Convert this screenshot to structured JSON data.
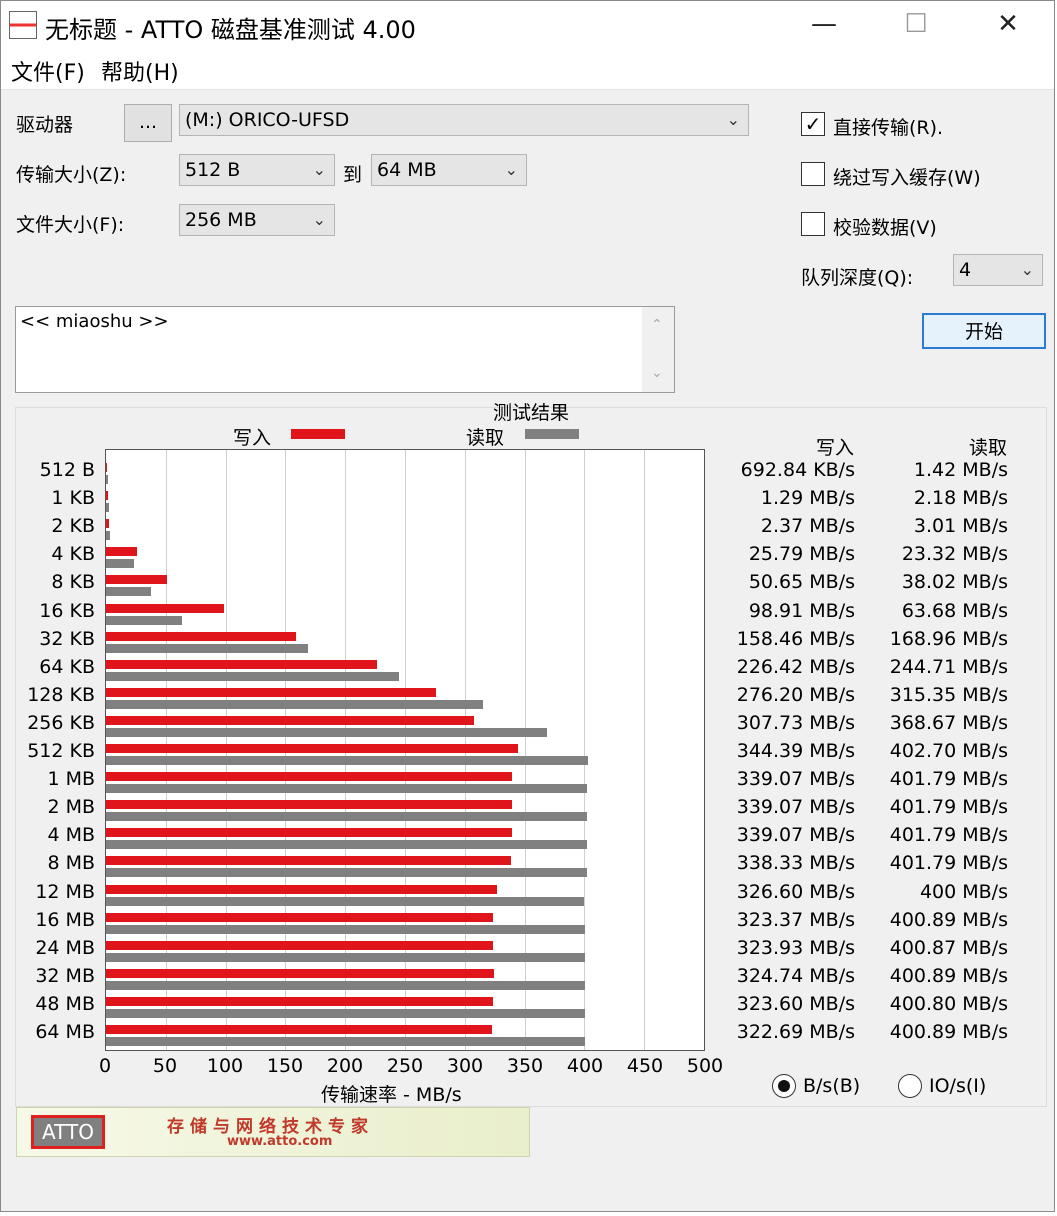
{
  "window": {
    "title": "无标题 - ATTO 磁盘基准测试 4.00",
    "minimize": "—",
    "maximize": "☐",
    "close": "✕"
  },
  "menu": [
    "文件(F)",
    "帮助(H)"
  ],
  "settings": {
    "drive_label": "驱动器",
    "browse_button": "...",
    "drive_value": "(M:) ORICO-UFSD",
    "transfer_label": "传输大小(Z):",
    "transfer_from": "512 B",
    "to_label": "到",
    "transfer_to": "64 MB",
    "file_size_label": "文件大小(F):",
    "file_size": "256 MB",
    "direct_io": {
      "label": "直接传输(R).",
      "checked": true
    },
    "bypass_cache": {
      "label": "绕过写入缓存(W)",
      "checked": false
    },
    "verify": {
      "label": "校验数据(V)",
      "checked": false
    },
    "queue_label": "队列深度(Q):",
    "queue_value": "4",
    "start_button": "开始"
  },
  "description": "<< miaoshu >>",
  "results": {
    "title": "测试结果",
    "legend_write": "写入",
    "legend_read": "读取",
    "col_write": "写入",
    "col_read": "读取",
    "write_color": "#e0151b",
    "read_color": "#808080",
    "rows": [
      {
        "size": "512 B",
        "write": "692.84 KB/s",
        "read": "1.42 MB/s"
      },
      {
        "size": "1 KB",
        "write": "1.29 MB/s",
        "read": "2.18 MB/s"
      },
      {
        "size": "2 KB",
        "write": "2.37 MB/s",
        "read": "3.01 MB/s"
      },
      {
        "size": "4 KB",
        "write": "25.79 MB/s",
        "read": "23.32 MB/s"
      },
      {
        "size": "8 KB",
        "write": "50.65 MB/s",
        "read": "38.02 MB/s"
      },
      {
        "size": "16 KB",
        "write": "98.91 MB/s",
        "read": "63.68 MB/s"
      },
      {
        "size": "32 KB",
        "write": "158.46 MB/s",
        "read": "168.96 MB/s"
      },
      {
        "size": "64 KB",
        "write": "226.42 MB/s",
        "read": "244.71 MB/s"
      },
      {
        "size": "128 KB",
        "write": "276.20 MB/s",
        "read": "315.35 MB/s"
      },
      {
        "size": "256 KB",
        "write": "307.73 MB/s",
        "read": "368.67 MB/s"
      },
      {
        "size": "512 KB",
        "write": "344.39 MB/s",
        "read": "402.70 MB/s"
      },
      {
        "size": "1 MB",
        "write": "339.07 MB/s",
        "read": "401.79 MB/s"
      },
      {
        "size": "2 MB",
        "write": "339.07 MB/s",
        "read": "401.79 MB/s"
      },
      {
        "size": "4 MB",
        "write": "339.07 MB/s",
        "read": "401.79 MB/s"
      },
      {
        "size": "8 MB",
        "write": "338.33 MB/s",
        "read": "401.79 MB/s"
      },
      {
        "size": "12 MB",
        "write": "326.60 MB/s",
        "read": "400 MB/s"
      },
      {
        "size": "16 MB",
        "write": "323.37 MB/s",
        "read": "400.89 MB/s"
      },
      {
        "size": "24 MB",
        "write": "323.93 MB/s",
        "read": "400.87 MB/s"
      },
      {
        "size": "32 MB",
        "write": "324.74 MB/s",
        "read": "400.89 MB/s"
      },
      {
        "size": "48 MB",
        "write": "323.60 MB/s",
        "read": "400.80 MB/s"
      },
      {
        "size": "64 MB",
        "write": "322.69 MB/s",
        "read": "400.89 MB/s"
      }
    ],
    "xlabel": "传输速率 - MB/s",
    "unit_bytes": "B/s(B)",
    "unit_io": "IO/s(I)",
    "unit_selected": "bytes"
  },
  "chart_data": {
    "type": "bar",
    "title": "测试结果",
    "xlabel": "传输速率 - MB/s",
    "xlim": [
      0,
      500
    ],
    "xticks": [
      "0",
      "50",
      "100",
      "150",
      "200",
      "250",
      "300",
      "350",
      "400",
      "450",
      "500"
    ],
    "categories": [
      "512 B",
      "1 KB",
      "2 KB",
      "4 KB",
      "8 KB",
      "16 KB",
      "32 KB",
      "64 KB",
      "128 KB",
      "256 KB",
      "512 KB",
      "1 MB",
      "2 MB",
      "4 MB",
      "8 MB",
      "12 MB",
      "16 MB",
      "24 MB",
      "32 MB",
      "48 MB",
      "64 MB"
    ],
    "series": [
      {
        "name": "写入",
        "values": [
          0.68,
          1.29,
          2.37,
          25.79,
          50.65,
          98.91,
          158.46,
          226.42,
          276.2,
          307.73,
          344.39,
          339.07,
          339.07,
          339.07,
          338.33,
          326.6,
          323.37,
          323.93,
          324.74,
          323.6,
          322.69
        ]
      },
      {
        "name": "读取",
        "values": [
          1.42,
          2.18,
          3.01,
          23.32,
          38.02,
          63.68,
          168.96,
          244.71,
          315.35,
          368.67,
          402.7,
          401.79,
          401.79,
          401.79,
          401.79,
          400,
          400.89,
          400.87,
          400.89,
          400.8,
          400.89
        ]
      }
    ],
    "grid": true,
    "legend": "top"
  },
  "banner": {
    "logo": "ATTO",
    "slogan": "存储与网络技术专家",
    "url": "www.atto.com"
  }
}
